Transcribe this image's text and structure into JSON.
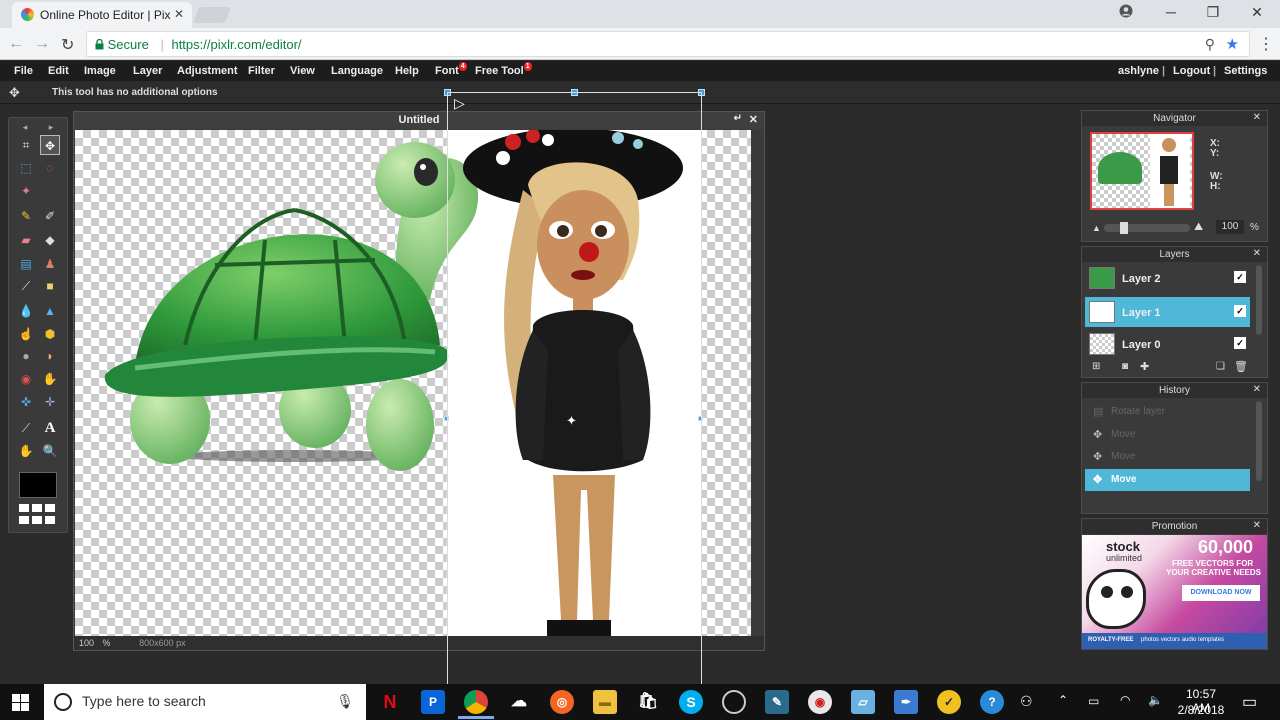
{
  "browser": {
    "tab_title": "Online Photo Editor | Pix",
    "tab_close": "✕",
    "minimize": "─",
    "restore": "❐",
    "close": "✕",
    "back": "←",
    "forward": "→",
    "reload": "↻",
    "secure_label": "Secure",
    "url": "https://pixlr.com/editor/",
    "zoom_icon": "⚲",
    "star_icon": "★",
    "menu_icon": "⋮"
  },
  "menu": {
    "items": [
      "File",
      "Edit",
      "Image",
      "Layer",
      "Adjustment",
      "Filter",
      "View",
      "Language",
      "Help"
    ],
    "font_label": "Font",
    "font_badge": "4",
    "freetool_label": "Free Tool",
    "freetool_badge": "1",
    "user": "ashlyne",
    "logout": "Logout",
    "settings": "Settings",
    "sep": "|"
  },
  "options": {
    "text": "This tool has no additional options"
  },
  "toolbox": {
    "top_left": "◂",
    "top_right": "▸"
  },
  "document": {
    "title": "Untitled",
    "zoom": "100",
    "zoom_unit": "%",
    "size": "800x600 px",
    "close": "✕",
    "restore": "↵"
  },
  "navigator": {
    "title": "Navigator",
    "x_label": "X:",
    "y_label": "Y:",
    "w_label": "W:",
    "h_label": "H:",
    "zoom_value": "100",
    "zoom_unit": "%",
    "zoom_slider_fraction": 0.2,
    "close": "✕"
  },
  "layers": {
    "title": "Layers",
    "close": "✕",
    "items": [
      {
        "name": "Layer 2",
        "visible": true,
        "selected": false
      },
      {
        "name": "Layer 1",
        "visible": true,
        "selected": true
      },
      {
        "name": "Layer 0",
        "visible": true,
        "selected": false
      }
    ],
    "check": "✓"
  },
  "history": {
    "title": "History",
    "close": "✕",
    "items": [
      {
        "label": "Rotate layer",
        "selected": false
      },
      {
        "label": "Move",
        "selected": false
      },
      {
        "label": "Move",
        "selected": false
      },
      {
        "label": "Move",
        "selected": true
      }
    ]
  },
  "promotion": {
    "title": "Promotion",
    "close": "✕",
    "brand": "stock",
    "brand_sub": "unlimited",
    "count": "60,000",
    "line1": "FREE VECTORS FOR",
    "line2": "YOUR CREATIVE NEEDS",
    "cta": "DOWNLOAD NOW",
    "footer": "ROYALTY-FREE",
    "footer_links": "photos   vectors   audio   templates"
  },
  "taskbar": {
    "search_placeholder": "Type here to search",
    "time": "10:57 AM",
    "date": "2/8/2018"
  },
  "colors": {
    "accent": "#4fb8d8",
    "menubar": "#1d1d1d",
    "panel": "#3a3a3a"
  }
}
